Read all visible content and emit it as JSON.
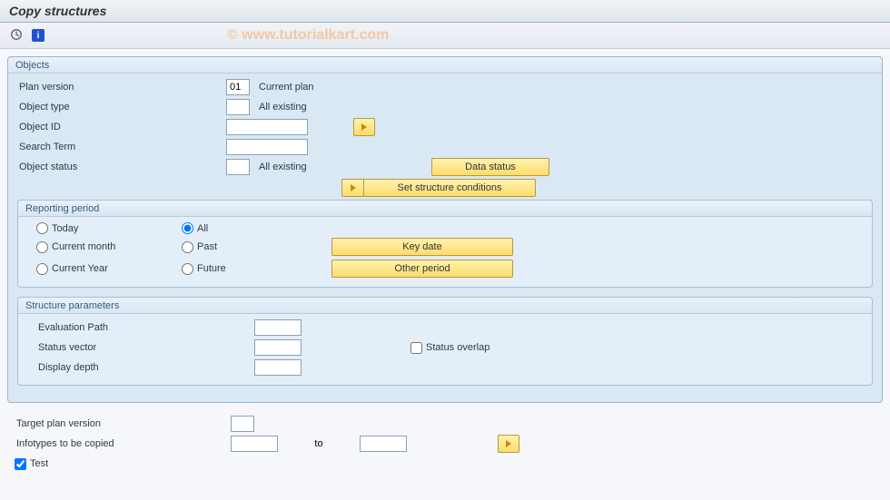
{
  "title": "Copy structures",
  "watermark": "© www.tutorialkart.com",
  "objects": {
    "title": "Objects",
    "plan_version_label": "Plan version",
    "plan_version_value": "01",
    "plan_version_desc": "Current plan",
    "object_type_label": "Object type",
    "object_type_value": "",
    "object_type_desc": "All existing",
    "object_id_label": "Object ID",
    "object_id_value": "",
    "search_term_label": "Search Term",
    "search_term_value": "",
    "object_status_label": "Object status",
    "object_status_value": "",
    "object_status_desc": "All existing",
    "data_status_btn": "Data status",
    "set_structure_btn": "Set structure conditions"
  },
  "reporting": {
    "title": "Reporting period",
    "today": "Today",
    "all": "All",
    "current_month": "Current month",
    "past": "Past",
    "current_year": "Current Year",
    "future": "Future",
    "selected": "all",
    "key_date_btn": "Key date",
    "other_period_btn": "Other period"
  },
  "structure_params": {
    "title": "Structure parameters",
    "evaluation_path_label": "Evaluation Path",
    "evaluation_path_value": "",
    "status_vector_label": "Status vector",
    "status_vector_value": "",
    "status_overlap_label": "Status overlap",
    "display_depth_label": "Display depth",
    "display_depth_value": ""
  },
  "bottom": {
    "target_plan_label": "Target plan version",
    "target_plan_value": "",
    "infotypes_label": "Infotypes to be copied",
    "infotypes_from": "",
    "infotypes_to_label": "to",
    "infotypes_to": "",
    "test_label": "Test",
    "test_checked": true
  }
}
